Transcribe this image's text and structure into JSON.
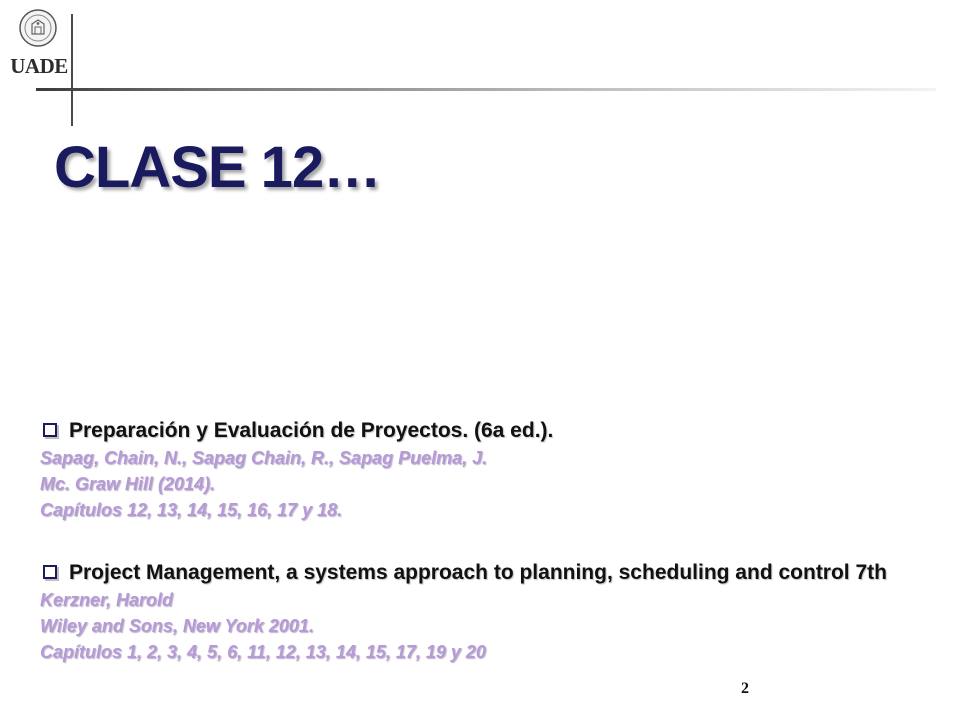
{
  "header": {
    "logo_text": "UADE",
    "logo_icon": "university-seal-icon"
  },
  "slide": {
    "title": "CLASE 12…",
    "page_number": "2"
  },
  "references": [
    {
      "title": "Preparación y Evaluación de Proyectos. (6a ed.).",
      "lines": [
        "Sapag, Chain, N., Sapag Chain, R., Sapag Puelma, J.",
        "Mc. Graw Hill (2014).",
        "Capítulos 12, 13, 14, 15, 16, 17 y 18."
      ]
    },
    {
      "title": "Project Management, a systems approach to planning, scheduling and control 7th",
      "lines": [
        "Kerzner, Harold",
        "Wiley and Sons, New York 2001.",
        "Capítulos 1, 2, 3, 4, 5, 6, 11, 12, 13, 14, 15, 17, 19 y 20"
      ]
    }
  ],
  "colors": {
    "title": "#1a1a5e",
    "reference_detail": "#b69ad8",
    "divider": "#3a3a3a"
  }
}
